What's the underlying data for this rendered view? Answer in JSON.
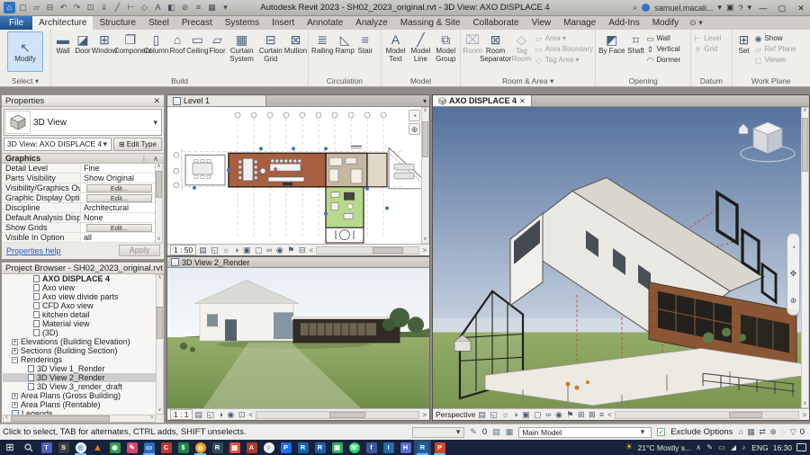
{
  "glyphs": {
    "dropdown": "▾",
    "up": "∧",
    "down": "∨",
    "left": "<",
    "right": ">",
    "close": "✕",
    "minimize": "—",
    "maximize": "▢",
    "check": "✓",
    "pin": "⋮",
    "search": "⌕",
    "help": "?",
    "cart": "▣",
    "start": "⊞"
  },
  "colors": {
    "accent_blue": "#2f74c0",
    "file_tab_blue": "#2a62a8",
    "selection_highlight": "#cfe4f8",
    "sky_top": "#54719d",
    "sky_bottom": "#c9d3e0",
    "ground_green": "#7f9c55",
    "taskbar_navy": "#16233b",
    "running_indicator": "#76b9ed",
    "plan_room_brown": "#a85f41",
    "plan_room_green": "#b8d98c"
  },
  "title_bar": {
    "title": "Autodesk Revit 2023 - SH02_2023_original.rvt - 3D View: AXO DISPLACE 4",
    "user": "samuel.macali...",
    "qat": [
      {
        "name": "home",
        "glyph": "⌂"
      },
      {
        "name": "cloud",
        "glyph": "▢"
      },
      {
        "name": "open",
        "glyph": "▱"
      },
      {
        "name": "save",
        "glyph": "⊟"
      },
      {
        "name": "undo",
        "glyph": "↶"
      },
      {
        "name": "redo",
        "glyph": "↷"
      },
      {
        "name": "print",
        "glyph": "⊡"
      },
      {
        "name": "export-pdf",
        "glyph": "⇓"
      },
      {
        "name": "measure",
        "glyph": "╱"
      },
      {
        "name": "aligned-dimension",
        "glyph": "⊢"
      },
      {
        "name": "tag",
        "glyph": "◇"
      },
      {
        "name": "text",
        "glyph": "A"
      },
      {
        "name": "default-3d-view",
        "glyph": "◧"
      },
      {
        "name": "section",
        "glyph": "⊘"
      },
      {
        "name": "thin-lines",
        "glyph": "≡"
      },
      {
        "name": "switch-windows",
        "glyph": "▦"
      },
      {
        "name": "customize",
        "glyph": "▾"
      }
    ]
  },
  "ribbon": {
    "tabs": [
      "File",
      "Architecture",
      "Structure",
      "Steel",
      "Precast",
      "Systems",
      "Insert",
      "Annotate",
      "Analyze",
      "Massing & Site",
      "Collaborate",
      "View",
      "Manage",
      "Add-Ins",
      "Modify"
    ],
    "modify_extra": "⊙ ▾",
    "panels": {
      "select": {
        "label": "Select ▾",
        "modify": {
          "label": "Modify",
          "glyph": "↖"
        }
      },
      "build": {
        "label": "Build",
        "items": [
          {
            "label": "Wall",
            "glyph": "▬"
          },
          {
            "label": "Door",
            "glyph": "◪"
          },
          {
            "label": "Window",
            "glyph": "⊞"
          },
          {
            "label": "Component",
            "glyph": "❒"
          },
          {
            "label": "Column",
            "glyph": "▯"
          },
          {
            "label": "Roof",
            "glyph": "⌂"
          },
          {
            "label": "Ceiling",
            "glyph": "▭"
          },
          {
            "label": "Floor",
            "glyph": "▱"
          },
          {
            "label": "Curtain System",
            "glyph": "▦"
          },
          {
            "label": "Curtain Grid",
            "glyph": "⊟"
          },
          {
            "label": "Mullion",
            "glyph": "⊠"
          }
        ]
      },
      "circulation": {
        "label": "Circulation",
        "items": [
          {
            "label": "Railing",
            "glyph": "≣"
          },
          {
            "label": "Ramp",
            "glyph": "◺"
          },
          {
            "label": "Stair",
            "glyph": "≡"
          }
        ]
      },
      "model": {
        "label": "Model",
        "items": [
          {
            "label": "Model Text",
            "glyph": "A"
          },
          {
            "label": "Model Line",
            "glyph": "╱"
          },
          {
            "label": "Model Group",
            "glyph": "⧉"
          }
        ]
      },
      "room_area": {
        "label": "Room & Area ▾",
        "big": [
          {
            "label": "Room",
            "glyph": "⌧"
          },
          {
            "label": "Room Separator",
            "glyph": "⊠"
          },
          {
            "label": "Tag Room",
            "glyph": "◇"
          }
        ],
        "small": [
          {
            "label": "Area ▾",
            "glyph": "▱"
          },
          {
            "label": "Area Boundary",
            "glyph": "▭"
          },
          {
            "label": "Tag Area ▾",
            "glyph": "◇"
          }
        ]
      },
      "opening": {
        "label": "Opening",
        "big": [
          {
            "label": "By Face",
            "glyph": "◩"
          },
          {
            "label": "Shaft",
            "glyph": "⌗"
          }
        ],
        "small": [
          {
            "label": "Wall",
            "glyph": "▭"
          },
          {
            "label": "Vertical",
            "glyph": "⇕"
          },
          {
            "label": "Dormer",
            "glyph": "◠"
          }
        ]
      },
      "datum": {
        "label": "Datum",
        "small": [
          {
            "label": "Level",
            "glyph": "⊢"
          },
          {
            "label": "Grid",
            "glyph": "#"
          }
        ]
      },
      "work_plane": {
        "label": "Work Plane",
        "big": [
          {
            "label": "Set",
            "glyph": "⊞"
          }
        ],
        "small": [
          {
            "label": "Show",
            "glyph": "◉"
          },
          {
            "label": "Ref Plane",
            "glyph": "▱"
          },
          {
            "label": "Viewer",
            "glyph": "◻"
          }
        ]
      }
    }
  },
  "properties": {
    "header": "Properties",
    "type_name": "3D View",
    "instance": "3D View: AXO DISPLACE 4",
    "edit_type": "Edit Type",
    "edit_type_glyph": "⊞",
    "section": "Graphics",
    "rows": [
      {
        "name": "Detail Level",
        "value": "Fine",
        "kind": "text"
      },
      {
        "name": "Parts Visibility",
        "value": "Show Original",
        "kind": "text"
      },
      {
        "name": "Visibility/Graphics Ov...",
        "value": "Edit...",
        "kind": "button"
      },
      {
        "name": "Graphic Display Optio...",
        "value": "Edit...",
        "kind": "button"
      },
      {
        "name": "Discipline",
        "value": "Architectural",
        "kind": "text"
      },
      {
        "name": "Default Analysis Displ...",
        "value": "None",
        "kind": "text"
      },
      {
        "name": "Show Grids",
        "value": "Edit...",
        "kind": "button"
      },
      {
        "name": "Visible In Option",
        "value": "all",
        "kind": "text"
      }
    ],
    "help": "Properties help",
    "apply": "Apply"
  },
  "project_browser": {
    "title": "Project Browser - SH02_2023_original.rvt",
    "items": [
      {
        "label": "AXO DISPLACE 4"
      },
      {
        "label": "Axo view"
      },
      {
        "label": "Axo view divide parts"
      },
      {
        "label": "CFD Axo view"
      },
      {
        "label": "kitchen detail"
      },
      {
        "label": "Material view"
      },
      {
        "label": "(3D)"
      },
      {
        "label": "Elevations (Building Elevation)",
        "exp": "+"
      },
      {
        "label": "Sections (Building Section)",
        "exp": "+"
      },
      {
        "label": "Renderings",
        "exp": "−"
      },
      {
        "label": "3D View 1_Render"
      },
      {
        "label": "3D View 2_Render"
      },
      {
        "label": "3D View 3_render_draft"
      },
      {
        "label": "Area Plans (Gross Building)",
        "exp": "+"
      },
      {
        "label": "Area Plans (Rentable)",
        "exp": "+"
      },
      {
        "label": "Legends",
        "exp": "+"
      }
    ]
  },
  "viewports": {
    "plan": {
      "tab": "Level 1",
      "scale": "1 : 50",
      "icons": "▤ ◱ ☼ ◑ ▣ ▢ ∞ ◉ ⚑ ⊟"
    },
    "render": {
      "tab": "3D View 2_Render",
      "scale": "1 : 1",
      "icons": "▤ ◱ ◑ ◉ ⊡"
    },
    "axo": {
      "tab": "AXO DISPLACE 4",
      "projection": "Perspective",
      "icons": "▤ ◱ ☼ ◑ ▣ ▢ ∞ ◉ ⚑ ⊞ ⊠ ≡"
    }
  },
  "status_bar": {
    "prompt": "Click to select, TAB for alternates, CTRL adds, SHIFT unselects.",
    "edit_glyph": "✎",
    "edit_count": "0",
    "icon1": "▤",
    "icon2": "▦",
    "main_model": "Main Model",
    "exclude_options": "Exclude Options",
    "right_icons": "⌂ ▦ ⇄ ⊕ ◌",
    "filter_glyph": "▽",
    "filter_count": "0"
  },
  "taskbar": {
    "apps": [
      {
        "name": "teams",
        "glyph": "T"
      },
      {
        "name": "dark-app",
        "glyph": "S"
      },
      {
        "name": "chrome",
        "glyph": "◎"
      },
      {
        "name": "vlc",
        "glyph": "▲"
      },
      {
        "name": "green-capture",
        "glyph": "◉"
      },
      {
        "name": "paint-app",
        "glyph": "✎"
      },
      {
        "name": "files-app",
        "glyph": "▭"
      },
      {
        "name": "c-app",
        "glyph": "C"
      },
      {
        "name": "finance-app",
        "glyph": "$"
      },
      {
        "name": "photos",
        "glyph": "◎"
      },
      {
        "name": "r-dark-app",
        "glyph": "R"
      },
      {
        "name": "grid-app",
        "glyph": "▦"
      },
      {
        "name": "autocad",
        "glyph": "A"
      },
      {
        "name": "white-circle-app",
        "glyph": "○"
      },
      {
        "name": "blue-p-app",
        "glyph": "P"
      },
      {
        "name": "revit-a",
        "glyph": "R"
      },
      {
        "name": "revit-b",
        "glyph": "R"
      },
      {
        "name": "green-box-app",
        "glyph": "▣"
      },
      {
        "name": "whatsapp",
        "glyph": "☏"
      },
      {
        "name": "facebook",
        "glyph": "f"
      },
      {
        "name": "office-app",
        "glyph": "I"
      },
      {
        "name": "h-app",
        "glyph": "H"
      },
      {
        "name": "revit-active",
        "glyph": "R"
      },
      {
        "name": "powerpoint",
        "glyph": "P"
      }
    ],
    "weather_glyph": "☀",
    "weather": "21°C Mostly s...",
    "tray_icons": "∧ ✎ ▭ ◢ ♪",
    "lang": "ENG",
    "time": "16:30"
  }
}
